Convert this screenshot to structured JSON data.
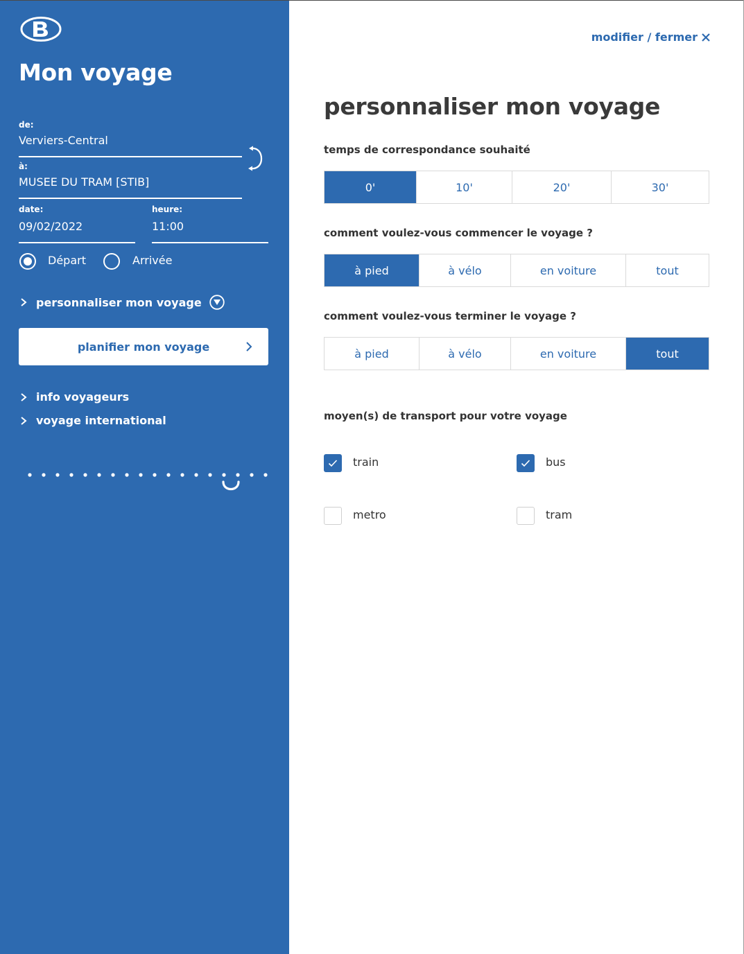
{
  "sidebar": {
    "title": "Mon voyage",
    "from_label": "de:",
    "from_value": "Verviers-Central",
    "to_label": "à:",
    "to_value": "MUSEE DU TRAM [STIB]",
    "date_label": "date:",
    "date_value": "09/02/2022",
    "time_label": "heure:",
    "time_value": "11:00",
    "radio_departure": "Départ",
    "radio_arrival": "Arrivée",
    "radio_selected": "Départ",
    "customize_link": "personnaliser mon voyage",
    "plan_button": "planifier mon voyage",
    "links": [
      "info voyageurs",
      "voyage international"
    ]
  },
  "main": {
    "close_link": "modifier / fermer",
    "title": "personnaliser mon voyage",
    "transfer": {
      "question": "temps de correspondance souhaité",
      "options": [
        "0'",
        "10'",
        "20'",
        "30'"
      ],
      "selected": "0'"
    },
    "start": {
      "question": "comment voulez-vous commencer le voyage ?",
      "options": [
        "à pied",
        "à vélo",
        "en voiture",
        "tout"
      ],
      "selected": "à pied"
    },
    "end": {
      "question": "comment voulez-vous terminer le voyage ?",
      "options": [
        "à pied",
        "à vélo",
        "en voiture",
        "tout"
      ],
      "selected": "tout"
    },
    "transport": {
      "question": "moyen(s) de transport pour votre voyage",
      "items": [
        {
          "label": "train",
          "checked": true
        },
        {
          "label": "bus",
          "checked": true
        },
        {
          "label": "metro",
          "checked": false
        },
        {
          "label": "tram",
          "checked": false
        }
      ]
    }
  },
  "colors": {
    "brand_blue": "#2d6ab0",
    "text_dark": "#333333"
  },
  "icons": [
    "sncb-logo",
    "swap-icon",
    "chevron-right-icon",
    "filter-icon",
    "close-icon",
    "check-icon"
  ]
}
